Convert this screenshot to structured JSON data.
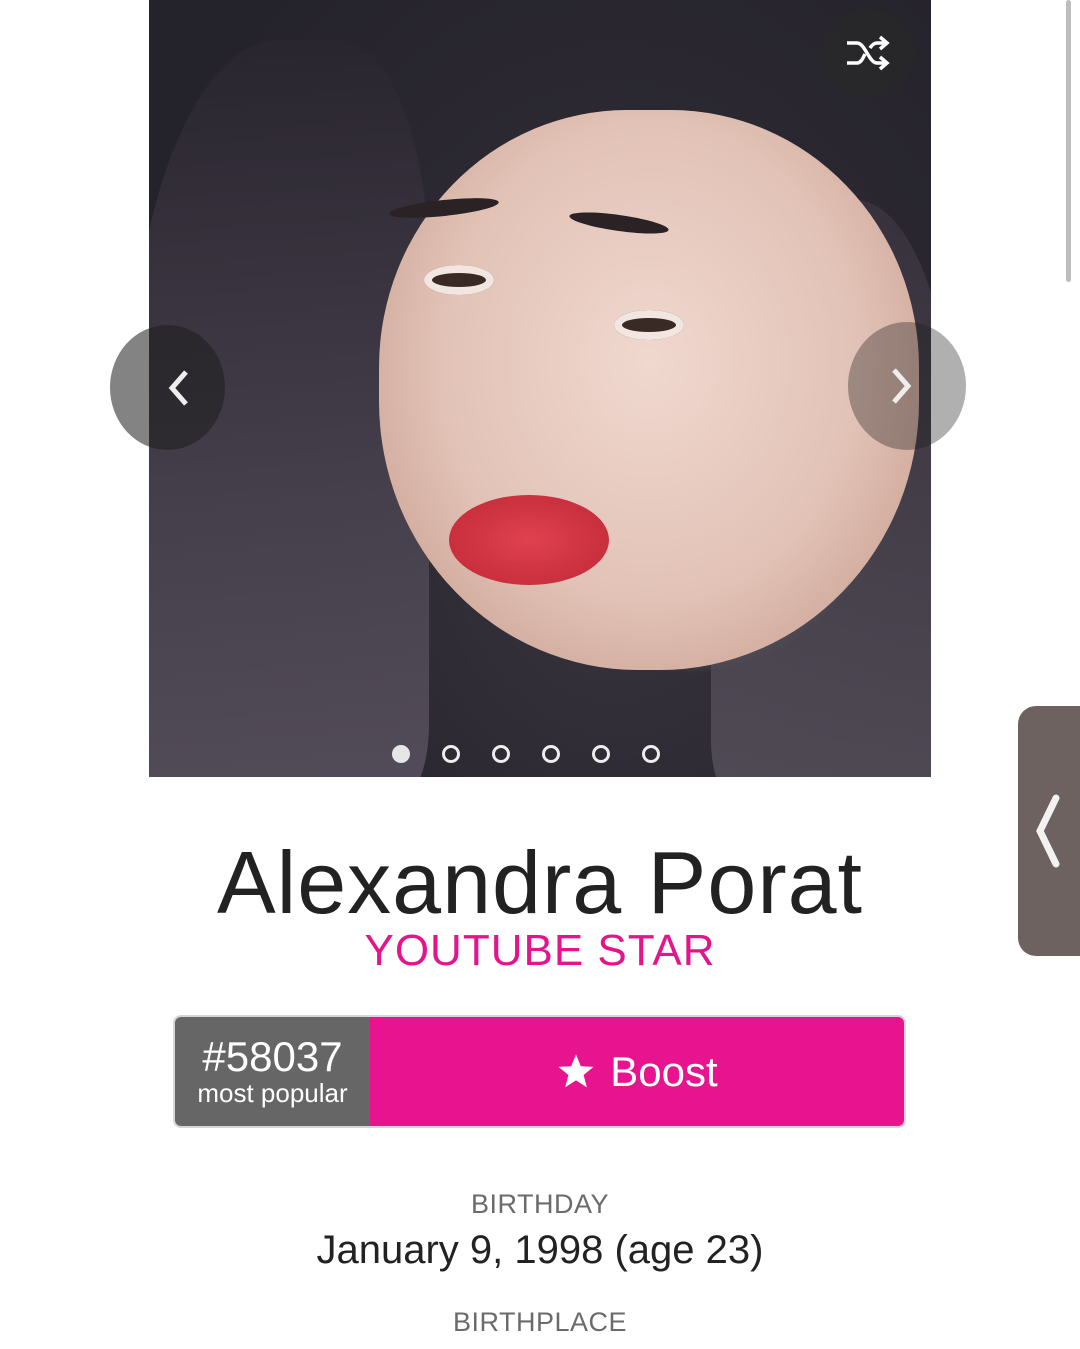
{
  "photo": {
    "dots_count": 6,
    "active_dot": 1
  },
  "profile": {
    "name": "Alexandra Porat",
    "profession": "YOUTUBE STAR"
  },
  "popularity": {
    "rank": "#58037",
    "rank_label": "most popular",
    "boost_label": "Boost"
  },
  "details": {
    "birthday_label": "BIRTHDAY",
    "birthday_value": "January 9, 1998 (age 23)",
    "birthplace_label": "BIRTHPLACE"
  },
  "icons": {
    "shuffle": "shuffle-icon",
    "prev": "chevron-left-icon",
    "next": "chevron-right-icon",
    "star": "star-icon",
    "side_tab": "chevron-left-icon"
  },
  "colors": {
    "accent": "#e8138e",
    "rank_bg": "#666666",
    "side_tab": "#6e6260"
  }
}
